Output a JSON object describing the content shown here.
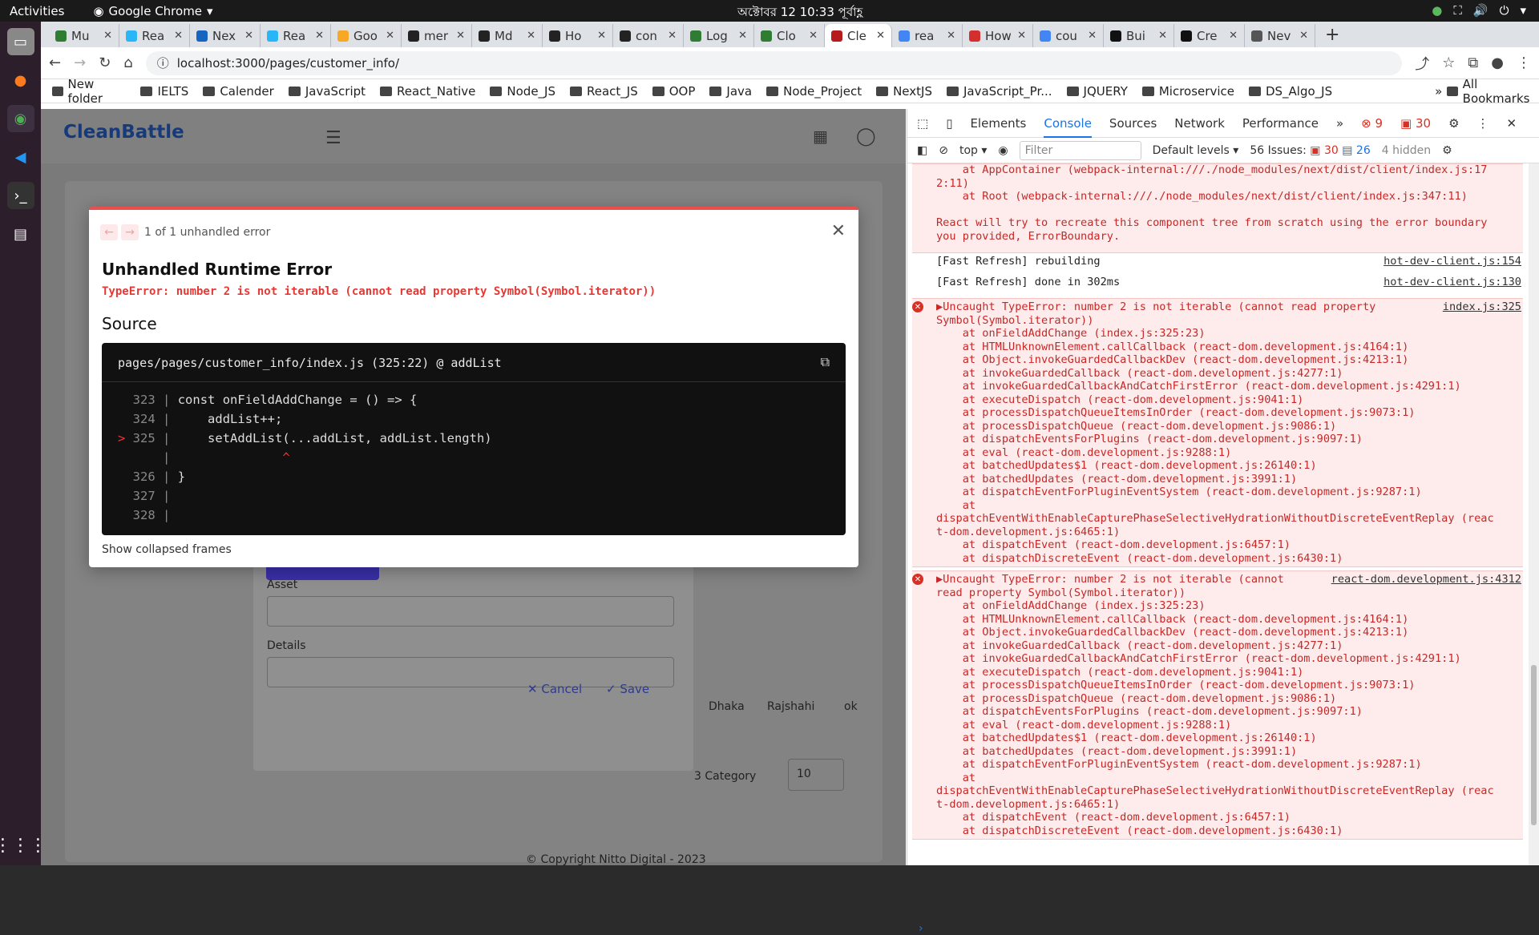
{
  "os": {
    "activities": "Activities",
    "browser_app": "Google Chrome",
    "clock": "অক্টোবর 12  10:33 পূর্বাহ্ণ"
  },
  "tabs": [
    {
      "label": "Mu",
      "color": "#2e7d32"
    },
    {
      "label": "Rea",
      "color": "#29b6f6"
    },
    {
      "label": "Nex",
      "color": "#1565c0"
    },
    {
      "label": "Rea",
      "color": "#29b6f6"
    },
    {
      "label": "Goo",
      "color": "#f9a825"
    },
    {
      "label": "mer",
      "color": "#222222"
    },
    {
      "label": "Md",
      "color": "#222222"
    },
    {
      "label": "Ho",
      "color": "#222222"
    },
    {
      "label": "con",
      "color": "#222222"
    },
    {
      "label": "Log",
      "color": "#2e7d32"
    },
    {
      "label": "Clo",
      "color": "#2e7d32"
    },
    {
      "label": "Cle",
      "color": "#b71c1c"
    },
    {
      "label": "rea",
      "color": "#4285f4"
    },
    {
      "label": "How",
      "color": "#d32f2f"
    },
    {
      "label": "cou",
      "color": "#4285f4"
    },
    {
      "label": "Bui",
      "color": "#111111"
    },
    {
      "label": "Cre",
      "color": "#111111"
    },
    {
      "label": "Nev",
      "color": "#555555"
    }
  ],
  "active_tab_index": 11,
  "url": "localhost:3000/pages/customer_info/",
  "bookmarks": [
    "New folder",
    "IELTS",
    "Calender",
    "JavaScript",
    "React_Native",
    "Node_JS",
    "React_JS",
    "OOP",
    "Java",
    "Node_Project",
    "NextJS",
    "JavaScript_Pr...",
    "JQUERY",
    "Microservice",
    "DS_Algo_JS"
  ],
  "bookmarks_all": "All Bookmarks",
  "app": {
    "logo": "CleanBattle",
    "footer": "© Copyright  Nitto Digital - 2023",
    "form": {
      "asset_label": "Asset",
      "details_label": "Details",
      "cancel": "Cancel",
      "save": "Save"
    },
    "table": {
      "cells": [
        "Dhaka",
        "Rajshahi",
        "ok"
      ],
      "category": "3 Category",
      "page_size": "10"
    }
  },
  "error_overlay": {
    "counter": "1 of 1 unhandled error",
    "title": "Unhandled Runtime Error",
    "message": "TypeError: number 2 is not iterable (cannot read property Symbol(Symbol.iterator))",
    "source_title": "Source",
    "file": "pages/pages/customer_info/index.js (325:22) @ addList",
    "code_lines": [
      {
        "n": "323",
        "code": "const onFieldAddChange = () => {"
      },
      {
        "n": "324",
        "code": "    addList++;"
      },
      {
        "n": "325",
        "code": "    setAddList(...addList, addList.length)"
      },
      {
        "n": "",
        "code": "              ^"
      },
      {
        "n": "326",
        "code": "}"
      },
      {
        "n": "327",
        "code": ""
      },
      {
        "n": "328",
        "code": ""
      }
    ],
    "collapsed": "Show collapsed frames"
  },
  "devtools": {
    "tabs": [
      "Elements",
      "Console",
      "Sources",
      "Network",
      "Performance"
    ],
    "errors": "9",
    "warnings": "30",
    "context": "top",
    "filter_placeholder": "Filter",
    "levels": "Default levels",
    "issues_label": "56 Issues:",
    "issues_err": "30",
    "issues_info": "26",
    "hidden": "4 hidden",
    "top_block": [
      "    at AppContainer (webpack-internal:///./node_modules/next/dist/client/index.js:17",
      "2:11)",
      "    at Root (webpack-internal:///./node_modules/next/dist/client/index.js:347:11)",
      "",
      "React will try to recreate this component tree from scratch using the error boundary",
      "you provided, ErrorBoundary."
    ],
    "fast1": "[Fast Refresh] rebuilding",
    "fast1_src": "hot-dev-client.js:154",
    "fast2": "[Fast Refresh] done in 302ms",
    "fast2_src": "hot-dev-client.js:130",
    "err1_head": "▶Uncaught TypeError: number 2 is not iterable (cannot read property",
    "err1_head2": "Symbol(Symbol.iterator))",
    "err1_src": "index.js:325",
    "err2_head": "▶Uncaught TypeError: number 2 is not iterable (cannot",
    "err2_head2": "read property Symbol(Symbol.iterator))",
    "err2_src": "react-dom.development.js:4312",
    "stack": [
      "    at onFieldAddChange (index.js:325:23)",
      "    at HTMLUnknownElement.callCallback (react-dom.development.js:4164:1)",
      "    at Object.invokeGuardedCallbackDev (react-dom.development.js:4213:1)",
      "    at invokeGuardedCallback (react-dom.development.js:4277:1)",
      "    at invokeGuardedCallbackAndCatchFirstError (react-dom.development.js:4291:1)",
      "    at executeDispatch (react-dom.development.js:9041:1)",
      "    at processDispatchQueueItemsInOrder (react-dom.development.js:9073:1)",
      "    at processDispatchQueue (react-dom.development.js:9086:1)",
      "    at dispatchEventsForPlugins (react-dom.development.js:9097:1)",
      "    at eval (react-dom.development.js:9288:1)",
      "    at batchedUpdates$1 (react-dom.development.js:26140:1)",
      "    at batchedUpdates (react-dom.development.js:3991:1)",
      "    at dispatchEventForPluginEventSystem (react-dom.development.js:9287:1)",
      "    at",
      "dispatchEventWithEnableCapturePhaseSelectiveHydrationWithoutDiscreteEventReplay (reac",
      "t-dom.development.js:6465:1)",
      "    at dispatchEvent (react-dom.development.js:6457:1)",
      "    at dispatchDiscreteEvent (react-dom.development.js:6430:1)"
    ]
  }
}
